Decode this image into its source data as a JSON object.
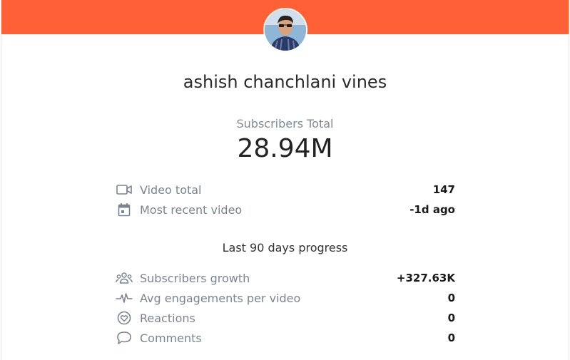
{
  "header": {
    "banner_color": "#ff6137",
    "avatar": "channel-avatar"
  },
  "channel": {
    "name": "ashish chanchlani vines"
  },
  "subscribers": {
    "label": "Subscribers Total",
    "value": "28.94M"
  },
  "stats": [
    {
      "icon": "video-camera-icon",
      "label": "Video total",
      "value": "147"
    },
    {
      "icon": "calendar-icon",
      "label": "Most recent video",
      "value": "-1d ago"
    }
  ],
  "progress": {
    "title": "Last 90 days progress",
    "rows": [
      {
        "icon": "people-icon",
        "label": "Subscribers growth",
        "value": "+327.63K"
      },
      {
        "icon": "pulse-icon",
        "label": "Avg engagements per video",
        "value": "0"
      },
      {
        "icon": "heart-circle-icon",
        "label": "Reactions",
        "value": "0"
      },
      {
        "icon": "speech-bubble-icon",
        "label": "Comments",
        "value": "0"
      }
    ]
  }
}
